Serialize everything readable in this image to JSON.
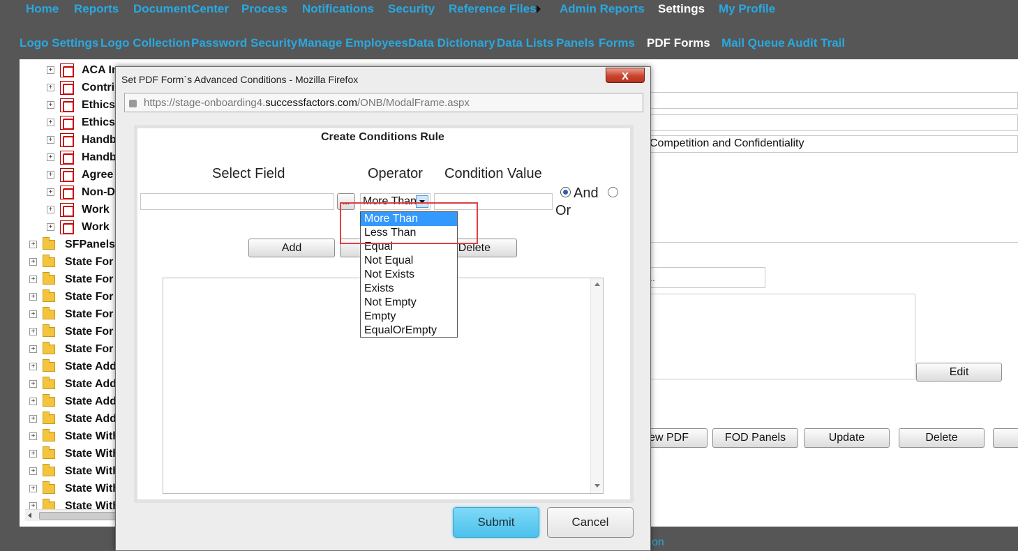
{
  "nav": {
    "top": [
      "Home",
      "Reports",
      "DocumentCenter",
      "Process",
      "Notifications",
      "Security",
      "Reference Files",
      "Admin Reports",
      "Settings",
      "My Profile"
    ],
    "sub": [
      "Logo Settings",
      "Logo Collection",
      "Password Security",
      "Manage Employees",
      "Data Dictionary",
      "Data Lists",
      "Panels",
      "Forms",
      "PDF Forms",
      "Mail Queue",
      "Audit Trail"
    ]
  },
  "tree": {
    "pdf_items": [
      "ACA In",
      "Contri",
      "Ethics",
      "Ethics",
      "Handb",
      "Handb",
      "Agree",
      "Non-D",
      "Work",
      "Work"
    ],
    "folders": [
      "SFPanels",
      "State For",
      "State For",
      "State For",
      "State For",
      "State For",
      "State For",
      "State Add",
      "State Add",
      "State Add",
      "State Add",
      "State With",
      "State With",
      "State With",
      "State With",
      "State With"
    ]
  },
  "background": {
    "field_text": "Competition and Confidentiality",
    "field_text2": "..",
    "buttons": {
      "edit": "Edit",
      "view_pdf": "ew PDF",
      "fod_panels": "FOD Panels",
      "update": "Update",
      "delete": "Delete"
    },
    "bottom_text": "on"
  },
  "modal": {
    "title": "Set PDF Form`s Advanced Conditions - Mozilla Firefox",
    "close": "x",
    "url_prefix": "https://stage-onboarding4.",
    "url_host": "successfactors.com",
    "url_path": "/ONB/ModalFrame.aspx",
    "heading": "Create Conditions Rule",
    "col_select": "Select Field",
    "col_operator": "Operator",
    "col_value": "Condition Value",
    "browse": "...",
    "operator_selected": "More Than",
    "and_label": "And",
    "or_label": "Or",
    "add": "Add",
    "delete": "Delete",
    "submit": "Submit",
    "cancel": "Cancel",
    "operator_options": [
      "More Than",
      "Less Than",
      "Equal",
      "Not Equal",
      "Not Exists",
      "Exists",
      "Not Empty",
      "Empty",
      "EqualOrEmpty"
    ]
  }
}
